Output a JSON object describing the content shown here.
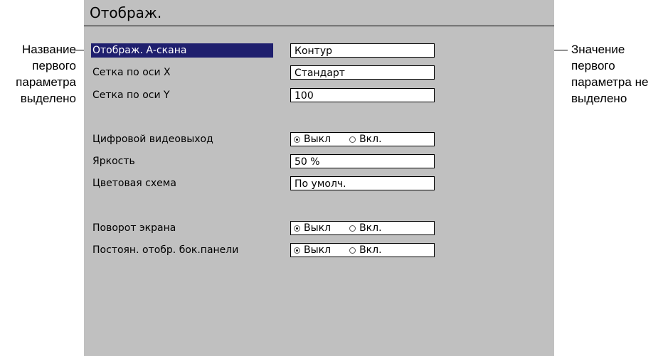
{
  "screen": {
    "title": "Отображ."
  },
  "params": [
    {
      "label": "Отображ. А-скана",
      "type": "text",
      "value": "Контур",
      "selected": true
    },
    {
      "label": "Сетка по оси X",
      "type": "text",
      "value": "Стандарт"
    },
    {
      "label": "Сетка по оси Y",
      "type": "text",
      "value": "100"
    },
    {
      "label": "Цифровой видеовыход",
      "type": "toggle",
      "options": [
        "Выкл",
        "Вкл."
      ],
      "checked": 0
    },
    {
      "label": "Яркость",
      "type": "text",
      "value": "50 %"
    },
    {
      "label": "Цветовая схема",
      "type": "text",
      "value": "По умолч."
    },
    {
      "label": "Поворот экрана",
      "type": "toggle",
      "options": [
        "Выкл",
        "Вкл."
      ],
      "checked": 0
    },
    {
      "label": "Постоян. отобр. бок.панели",
      "type": "toggle",
      "options": [
        "Выкл",
        "Вкл."
      ],
      "checked": 0
    }
  ],
  "annotations": {
    "left": [
      "Название",
      "первого",
      "параметра",
      "выделено"
    ],
    "right": [
      "Значение",
      "первого",
      "параметра не",
      "выделено"
    ]
  },
  "colors": {
    "screen_background": "#c0c0c0",
    "selection": "#1f1f6e"
  }
}
